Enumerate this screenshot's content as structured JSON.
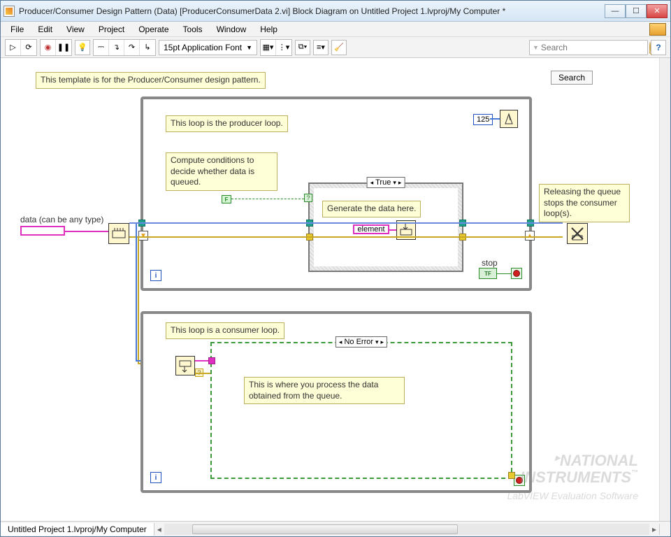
{
  "titlebar": {
    "title": "Producer/Consumer Design Pattern (Data) [ProducerConsumerData 2.vi] Block Diagram on Untitled Project 1.lvproj/My Computer *"
  },
  "menu": {
    "items": [
      "File",
      "Edit",
      "View",
      "Project",
      "Operate",
      "Tools",
      "Window",
      "Help"
    ]
  },
  "toolbar": {
    "font_label": "15pt Application Font",
    "search_placeholder": "Search",
    "help_label": "?"
  },
  "diagram": {
    "template_note": "This template is for the Producer/Consumer design pattern.",
    "search_button": "Search",
    "producer_note": "This loop is the producer loop.",
    "compute_note": "Compute conditions to decide whether data is queued.",
    "release_note": "Releasing the queue stops the consumer loop(s).",
    "generate_note": "Generate the data here.",
    "consumer_note": "This loop is a consumer loop.",
    "process_note": "This is where you process the data obtained from the queue.",
    "data_label": "data (can be any type)",
    "element_label": "element",
    "stop_label": "stop",
    "timer_ms": "125",
    "true_case": "True",
    "noerror_case": "No Error",
    "false_const": "F",
    "tf_label": "TF",
    "i_label": "i"
  },
  "status": {
    "project_path": "Untitled Project 1.lvproj/My Computer"
  },
  "watermark": {
    "line1": "NATIONAL",
    "line2": "INSTRUMENTS",
    "line3": "LabVIEW  Evaluation Software"
  }
}
